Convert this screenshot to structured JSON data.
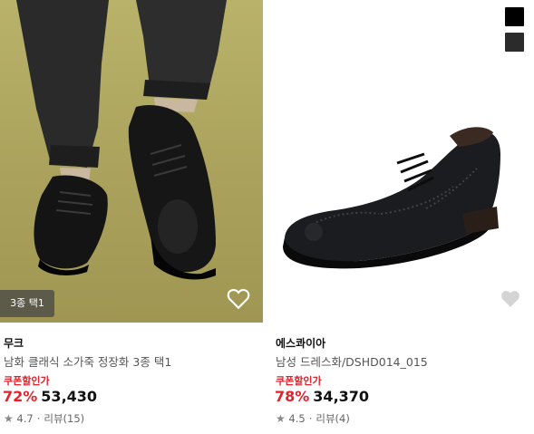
{
  "products": [
    {
      "option_badge": "3종 택1",
      "brand": "무크",
      "name": "남화 클래식 소가죽 정장화 3종 택1",
      "coupon_label": "쿠폰할인가",
      "discount": "72%",
      "price": "53,430",
      "rating": "4.7",
      "reviews": "리뷰(15)",
      "icons": [
        "heart-icon",
        "star-icon"
      ]
    },
    {
      "brand": "에스콰이아",
      "name": "남성 드레스화/DSHD014_015",
      "coupon_label": "쿠폰할인가",
      "discount": "78%",
      "price": "34,370",
      "rating": "4.5",
      "reviews": "리뷰(4)",
      "color_swatches": [
        "#000000",
        "#2b2b2b"
      ],
      "icons": [
        "heart-icon",
        "star-icon"
      ]
    }
  ],
  "colors": {
    "accent": "#e5222a",
    "text": "#111111",
    "muted": "#666666"
  }
}
